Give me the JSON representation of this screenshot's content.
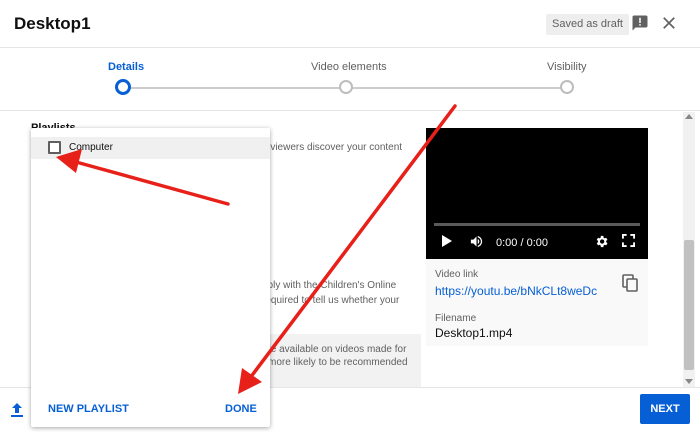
{
  "header": {
    "title": "Desktop1",
    "draft_badge": "Saved as draft",
    "feedback_icon": "feedback-icon",
    "close_icon": "close-icon"
  },
  "stepper": {
    "steps": [
      {
        "label": "Details",
        "active": true
      },
      {
        "label": "Video elements",
        "active": false
      },
      {
        "label": "Visibility",
        "active": false
      }
    ]
  },
  "main": {
    "playlists_heading": "Playlists",
    "playlists_description_tail": "o viewers discover your content",
    "audience_text_line1": "nply with the Children's Online",
    "audience_text_line2": "required to tell us whether your",
    "info_line1": "te available on videos made for",
    "info_line2": "more likely to be recommended"
  },
  "video": {
    "time": "0:00 / 0:00",
    "progress": 0.0,
    "link_label": "Video link",
    "link_value": "https://youtu.be/bNkCLt8weDc",
    "filename_label": "Filename",
    "filename_value": "Desktop1.mp4"
  },
  "playlist_dropdown": {
    "items": [
      {
        "label": "Computer",
        "checked": false
      }
    ],
    "new_playlist_label": "NEW PLAYLIST",
    "done_label": "DONE"
  },
  "footer": {
    "next_label": "NEXT",
    "upload_icon": "upload-icon"
  },
  "colors": {
    "accent": "#065fd4",
    "annotation_arrow": "#e8201a"
  }
}
